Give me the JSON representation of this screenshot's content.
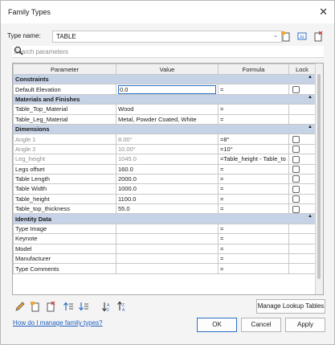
{
  "window": {
    "title": "Family Types",
    "close_glyph": "✕"
  },
  "type_name": {
    "label": "Type name:",
    "value": "TABLE"
  },
  "search": {
    "placeholder": "Search parameters"
  },
  "columns": [
    "Parameter",
    "Value",
    "Formula",
    "Lock"
  ],
  "groups": {
    "constraints": "Constraints",
    "materials": "Materials and Finishes",
    "dimensions": "Dimensions",
    "identity": "Identity Data"
  },
  "rows": {
    "default_elevation": {
      "name": "Default Elevation",
      "value": "0.0",
      "formula": "="
    },
    "table_top_material": {
      "name": "Table_Top_Material",
      "value": "Wood",
      "formula": "="
    },
    "table_leg_material": {
      "name": "Table_Leg_Material",
      "value": "Metal, Powder Coated, White",
      "formula": "="
    },
    "angle1": {
      "name": "Angle 1",
      "value": "8.00°",
      "formula": "=8°"
    },
    "angle2": {
      "name": "Angle 2",
      "value": "10.00°",
      "formula": "=10°"
    },
    "leg_height": {
      "name": "Leg_height",
      "value": "1045.0",
      "formula": "=Table_height - Table_to"
    },
    "legs_offset": {
      "name": "Legs offset",
      "value": "160.0",
      "formula": "="
    },
    "table_length": {
      "name": "Table Length",
      "value": "2000.0",
      "formula": "="
    },
    "table_width": {
      "name": "Table Width",
      "value": "1000.0",
      "formula": "="
    },
    "table_height": {
      "name": "Table_height",
      "value": "1100.0",
      "formula": "="
    },
    "table_top_thickness": {
      "name": "Table_top_thickness",
      "value": "55.0",
      "formula": "="
    },
    "type_image": {
      "name": "Type Image",
      "value": "",
      "formula": "="
    },
    "keynote": {
      "name": "Keynote",
      "value": "",
      "formula": "="
    },
    "model": {
      "name": "Model",
      "value": "",
      "formula": "="
    },
    "manufacturer": {
      "name": "Manufacturer",
      "value": "",
      "formula": "="
    },
    "type_comments": {
      "name": "Type Comments",
      "value": "",
      "formula": "="
    }
  },
  "buttons": {
    "manage_lookup": "Manage Lookup Tables",
    "ok": "OK",
    "cancel": "Cancel",
    "apply": "Apply"
  },
  "help_link": "How do I manage family types?",
  "icons": [
    "new-type-icon",
    "rename-type-icon",
    "delete-type-icon",
    "search-icon",
    "pencil-icon",
    "new-parameter-icon",
    "delete-parameter-icon",
    "move-up-icon",
    "move-down-icon",
    "sort-ascending-icon",
    "sort-descending-icon"
  ]
}
